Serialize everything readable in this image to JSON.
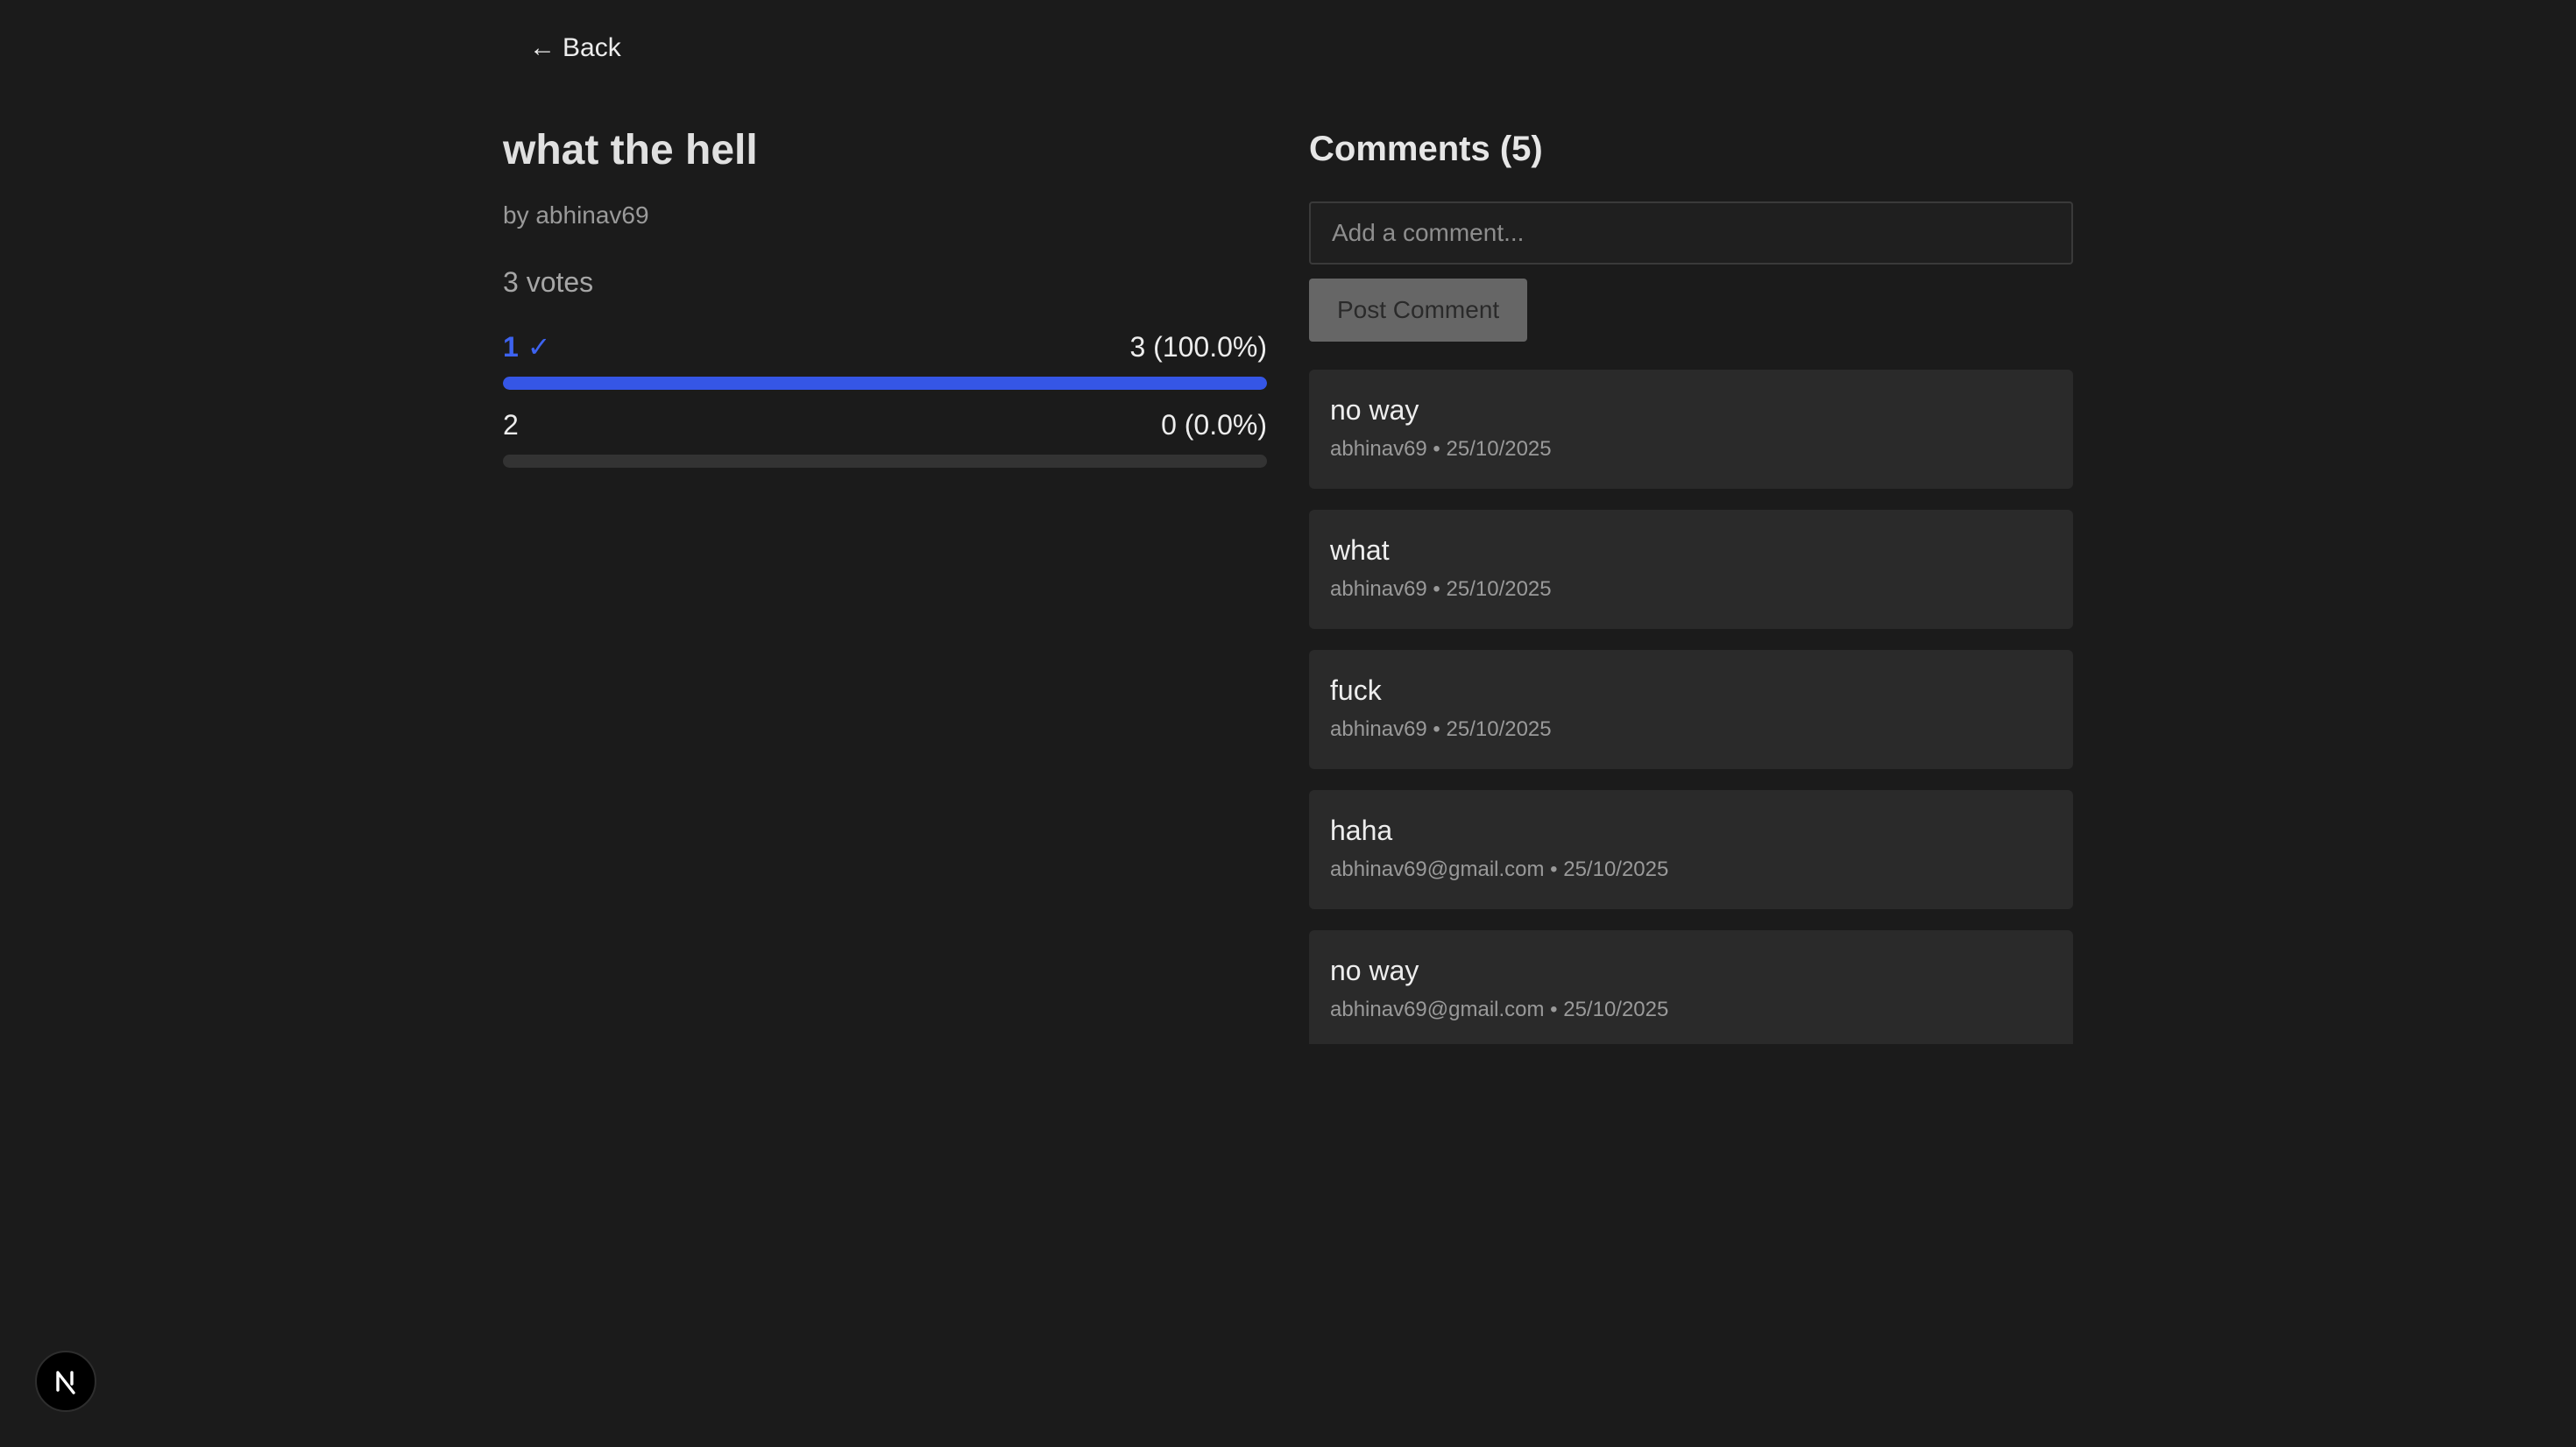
{
  "nav": {
    "back_arrow": "←",
    "back_label": "Back"
  },
  "poll": {
    "title": "what the hell",
    "author": "by abhinav69",
    "votes": "3 votes",
    "options": [
      {
        "label": "1",
        "check": "✓",
        "selected": true,
        "result": "3 (100.0%)",
        "fraction": 1.0
      },
      {
        "label": "2",
        "check": "",
        "selected": false,
        "result": "0 (0.0%)",
        "fraction": 0.0
      }
    ]
  },
  "comments": {
    "heading": "Comments (5)",
    "input_placeholder": "Add a comment...",
    "post_label": "Post Comment",
    "items": [
      {
        "text": "no way",
        "meta": "abhinav69 • 25/10/2025"
      },
      {
        "text": "what",
        "meta": "abhinav69 • 25/10/2025"
      },
      {
        "text": "fuck",
        "meta": "abhinav69 • 25/10/2025"
      },
      {
        "text": "haha",
        "meta": "abhinav69@gmail.com • 25/10/2025"
      },
      {
        "text": "no way",
        "meta": "abhinav69@gmail.com • 25/10/2025"
      }
    ]
  },
  "dev_badge": {
    "icon": "nextjs-logo-icon"
  },
  "colors": {
    "accent": "#3556e6",
    "background": "#1b1b1b",
    "card": "#2a2a2a"
  }
}
